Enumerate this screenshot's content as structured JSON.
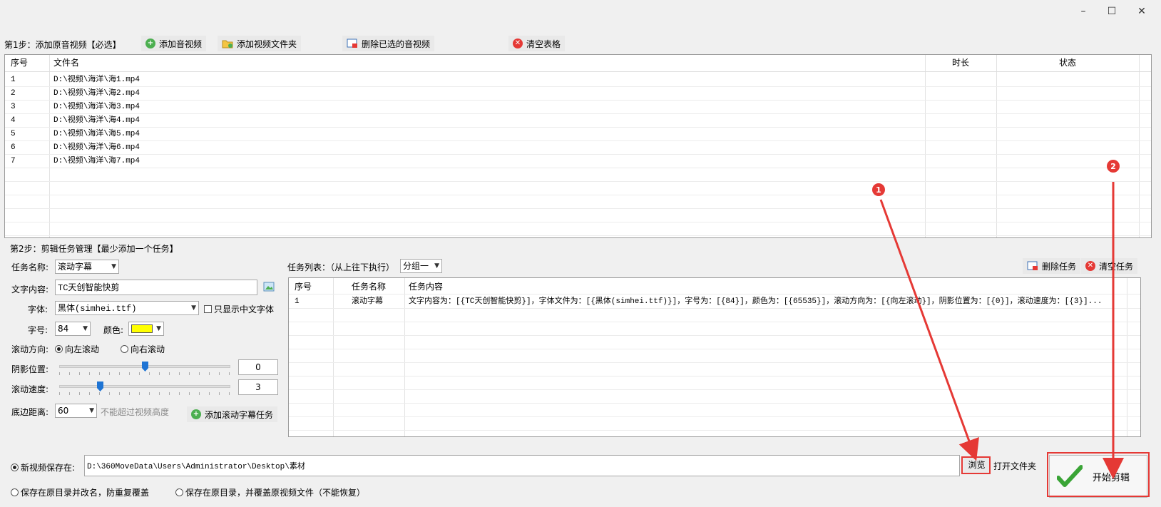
{
  "window": {
    "minimize": "–",
    "maximize": "☐",
    "close": "✕"
  },
  "step1": {
    "title": "第1步：添加原音视频【必选】",
    "buttons": {
      "add_video": "添加音视频",
      "add_folder": "添加视频文件夹",
      "delete_selected": "删除已选的音视频",
      "clear_table": "清空表格"
    },
    "columns": [
      "序号",
      "文件名",
      "时长",
      "状态"
    ],
    "rows": [
      [
        "1",
        "D:\\视频\\海洋\\海1.mp4",
        "",
        ""
      ],
      [
        "2",
        "D:\\视频\\海洋\\海2.mp4",
        "",
        ""
      ],
      [
        "3",
        "D:\\视频\\海洋\\海3.mp4",
        "",
        ""
      ],
      [
        "4",
        "D:\\视频\\海洋\\海4.mp4",
        "",
        ""
      ],
      [
        "5",
        "D:\\视频\\海洋\\海5.mp4",
        "",
        ""
      ],
      [
        "6",
        "D:\\视频\\海洋\\海6.mp4",
        "",
        ""
      ],
      [
        "7",
        "D:\\视频\\海洋\\海7.mp4",
        "",
        ""
      ]
    ]
  },
  "step2": {
    "title": "第2步：剪辑任务管理【最少添加一个任务】",
    "task_name_label": "任务名称:",
    "task_name_value": "滚动字幕",
    "text_label": "文字内容:",
    "text_value": "TC天创智能快剪",
    "font_label": "字体:",
    "font_value": "黑体(simhei.ttf)",
    "chinese_only_label": "只显示中文字体",
    "size_label": "字号:",
    "size_value": "84",
    "color_label": "颜色:",
    "color_value": "#ffff00",
    "direction_label": "滚动方向:",
    "direction_left": "向左滚动",
    "direction_right": "向右滚动",
    "shadow_label": "阴影位置:",
    "shadow_value": "0",
    "shadow_fraction": 0.5,
    "speed_label": "滚动速度:",
    "speed_value": "3",
    "speed_fraction": 0.23,
    "bottom_label": "底边距离:",
    "bottom_value": "60",
    "bottom_hint": "不能超过视频高度",
    "add_task_button": "添加滚动字幕任务",
    "task_list_label": "任务列表：（从上往下执行）",
    "group_value": "分组一",
    "delete_task": "删除任务",
    "clear_tasks": "清空任务",
    "task_columns": [
      "序号",
      "任务名称",
      "任务内容"
    ],
    "task_rows": [
      [
        "1",
        "滚动字幕",
        "文字内容为：[{TC天创智能快剪}]，字体文件为：[{黑体(simhei.ttf)}]，字号为：[{84}]，颜色为：[{65535}]，滚动方向为：[{向左滚动}]，阴影位置为：[{0}]，滚动速度为：[{3}]..."
      ]
    ]
  },
  "output": {
    "save_new_label": "新视频保存在:",
    "save_path": "D:\\360MoveData\\Users\\Administrator\\Desktop\\素材",
    "browse": "浏览",
    "open_folder": "打开文件夹",
    "save_rename": "保存在原目录并改名，防重复覆盖",
    "save_overwrite": "保存在原目录，并覆盖原视频文件（不能恢复）",
    "start": "开始剪辑"
  },
  "annotations": {
    "badge1": "1",
    "badge2": "2"
  },
  "colors": {
    "annotation_red": "#e53935",
    "check_green": "#3aa436"
  }
}
